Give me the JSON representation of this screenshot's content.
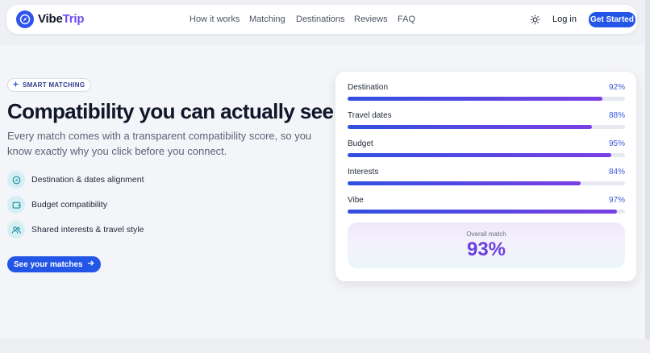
{
  "brand": {
    "name_part1": "Vibe",
    "name_part2": "Trip"
  },
  "nav": {
    "links": [
      "How it works",
      "Matching",
      "Destinations",
      "Reviews",
      "FAQ"
    ],
    "login": "Log in",
    "cta": "Get Started"
  },
  "hero": {
    "badge": "SMART MATCHING",
    "headline": "Compatibility you can actually see",
    "subtext": "Every match comes with a transparent compatibility score, so you know exactly why you click before you connect.",
    "features": [
      {
        "label": "Destination & dates alignment",
        "icon": "compass-icon"
      },
      {
        "label": "Budget compatibility",
        "icon": "wallet-icon"
      },
      {
        "label": "Shared interests & travel style",
        "icon": "users-icon"
      }
    ],
    "cta": "See your matches"
  },
  "card": {
    "metrics": [
      {
        "label": "Destination",
        "value": "92%",
        "fraction": 0.92
      },
      {
        "label": "Travel dates",
        "value": "88%",
        "fraction": 0.88
      },
      {
        "label": "Budget",
        "value": "95%",
        "fraction": 0.95
      },
      {
        "label": "Interests",
        "value": "84%",
        "fraction": 0.84
      },
      {
        "label": "Vibe",
        "value": "97%",
        "fraction": 0.97
      }
    ],
    "overall_label": "Overall match",
    "overall_value": "93%"
  },
  "colors": {
    "primary": "#2356e6",
    "accent": "#6c3fe0",
    "feature_bg": "#d4f0f4"
  }
}
